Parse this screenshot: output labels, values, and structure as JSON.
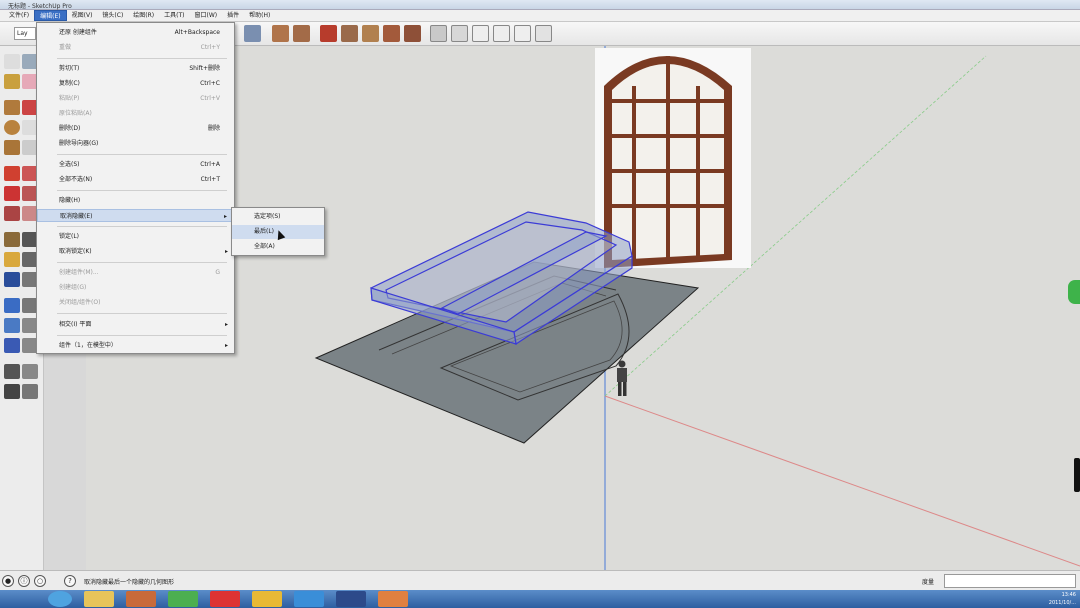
{
  "window": {
    "title": "无标题 - SketchUp Pro"
  },
  "menubar": {
    "items": [
      "文件(F)",
      "编辑(E)",
      "视图(V)",
      "镜头(C)",
      "绘图(R)",
      "工具(T)",
      "窗口(W)",
      "插件",
      "帮助(H)"
    ],
    "active_index": 1
  },
  "toolbar": {
    "layer_label": "Lay"
  },
  "edit_menu": {
    "items": [
      {
        "label": "还原 创建组件",
        "shortcut": "Alt+Backspace",
        "disabled": false
      },
      {
        "label": "重做",
        "shortcut": "Ctrl+Y",
        "disabled": true
      },
      {
        "label": "剪切(T)",
        "shortcut": "Shift+删除",
        "disabled": false
      },
      {
        "label": "复制(C)",
        "shortcut": "Ctrl+C",
        "disabled": false
      },
      {
        "label": "粘贴(P)",
        "shortcut": "Ctrl+V",
        "disabled": true
      },
      {
        "label": "原位粘贴(A)",
        "shortcut": "",
        "disabled": true
      },
      {
        "label": "删除(D)",
        "shortcut": "删除",
        "disabled": false
      },
      {
        "label": "删除导向器(G)",
        "shortcut": "",
        "disabled": false
      },
      {
        "label": "全选(S)",
        "shortcut": "Ctrl+A",
        "disabled": false
      },
      {
        "label": "全部不选(N)",
        "shortcut": "Ctrl+T",
        "disabled": false
      },
      {
        "label": "隐藏(H)",
        "shortcut": "",
        "disabled": false
      },
      {
        "label": "取消隐藏(E)",
        "shortcut": "",
        "disabled": false,
        "submenu": true,
        "highlighted": true
      },
      {
        "label": "锁定(L)",
        "shortcut": "",
        "disabled": false
      },
      {
        "label": "取消锁定(K)",
        "shortcut": "",
        "disabled": false,
        "submenu": true
      },
      {
        "label": "创建组件(M)...",
        "shortcut": "G",
        "disabled": true
      },
      {
        "label": "创建组(G)",
        "shortcut": "",
        "disabled": true
      },
      {
        "label": "关闭组/组件(O)",
        "shortcut": "",
        "disabled": true
      },
      {
        "label": "相交(I) 平面",
        "shortcut": "",
        "disabled": false,
        "submenu": true
      },
      {
        "label": "组件（1，在模型中）",
        "shortcut": "",
        "disabled": false,
        "submenu": true
      }
    ]
  },
  "unhide_submenu": {
    "items": [
      {
        "label": "选定项(S)",
        "highlighted": false
      },
      {
        "label": "最后(L)",
        "highlighted": true
      },
      {
        "label": "全部(A)",
        "highlighted": false
      }
    ]
  },
  "statusbar": {
    "hint": "取消隐藏最后一个隐藏的几何图形",
    "measure_label": "度量",
    "measure_value": ""
  },
  "taskbar": {
    "clock_time": "13:46",
    "clock_date": "2011/10/..."
  },
  "colors": {
    "menu_highlight": "#cfdcef",
    "selection_blue": "#3b3bd6",
    "ground_gray": "#7b8387",
    "window_wood": "#7a3a22",
    "taskbar_blue": "#2d5ea0"
  }
}
